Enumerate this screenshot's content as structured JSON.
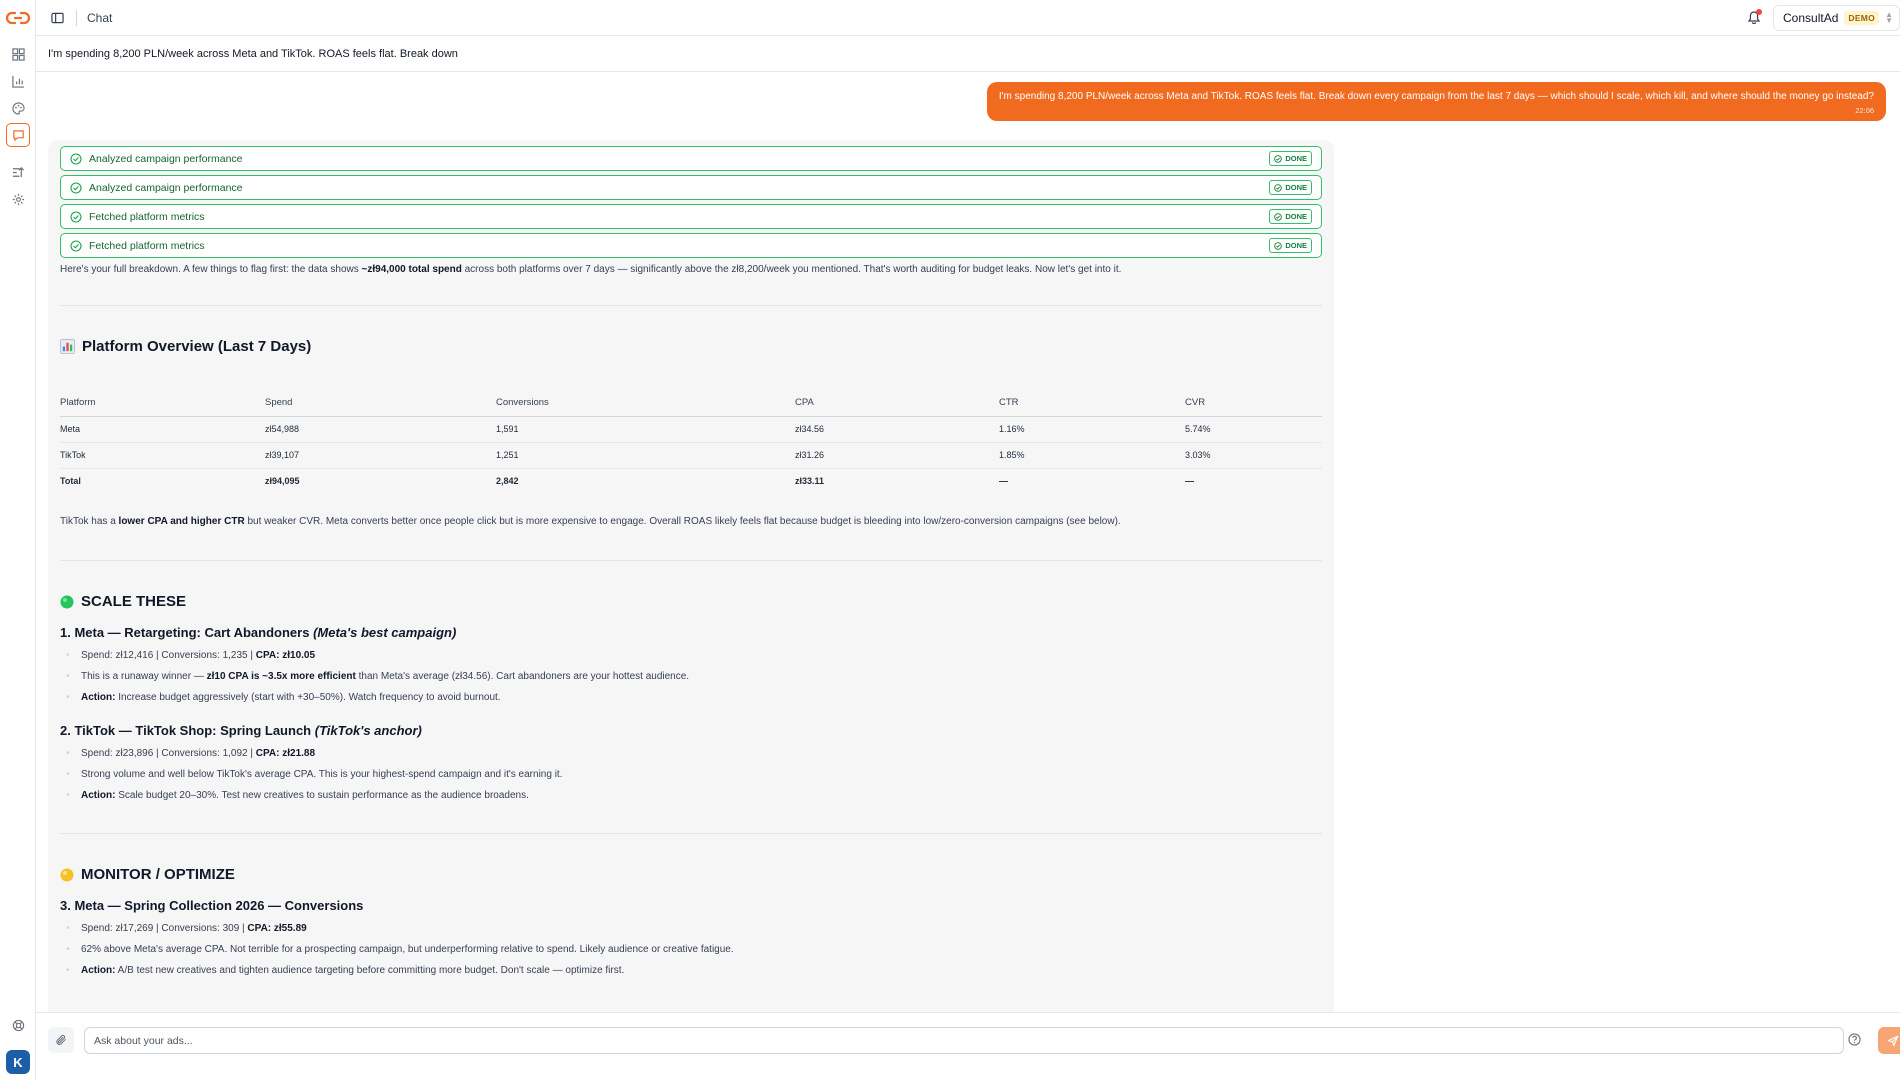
{
  "app": {
    "title": "Chat",
    "workspace": "ConsultAd",
    "workspace_badge": "DEMO",
    "avatar_initial": "K"
  },
  "conversation": {
    "title": "I'm spending 8,200 PLN/week across Meta and TikTok. ROAS feels flat. Break down"
  },
  "user_message": {
    "text": "I'm spending 8,200 PLN/week across Meta and TikTok. ROAS feels flat. Break down every campaign from the last 7 days — which should I scale, which kill, and where should the money go instead?",
    "time": "22:06"
  },
  "tool_calls": [
    {
      "label": "Analyzed campaign performance",
      "status": "DONE"
    },
    {
      "label": "Analyzed campaign performance",
      "status": "DONE"
    },
    {
      "label": "Fetched platform metrics",
      "status": "DONE"
    },
    {
      "label": "Fetched platform metrics",
      "status": "DONE"
    }
  ],
  "reply": {
    "intro_a": "Here's your full breakdown. A few things to flag first: the data shows ",
    "intro_b": "~zł94,000 total spend",
    "intro_c": " across both platforms over 7 days — significantly above the zł8,200/week you mentioned. That's worth auditing for budget leaks. Now let's get into it.",
    "overview_heading": "Platform Overview (Last 7 Days)",
    "table": {
      "headers": [
        "Platform",
        "Spend",
        "Conversions",
        "CPA",
        "CTR",
        "CVR"
      ],
      "rows": [
        [
          "Meta",
          "zł54,988",
          "1,591",
          "zł34.56",
          "1.16%",
          "5.74%"
        ],
        [
          "TikTok",
          "zł39,107",
          "1,251",
          "zł31.26",
          "1.85%",
          "3.03%"
        ]
      ],
      "total": [
        "Total",
        "zł94,095",
        "2,842",
        "zł33.11",
        "—",
        "—"
      ]
    },
    "summary_a": "TikTok has a ",
    "summary_b": "lower CPA and higher CTR",
    "summary_c": " but weaker CVR. Meta converts better once people click but is more expensive to engage. Overall ROAS likely feels flat because budget is bleeding into low/zero-conversion campaigns (see below).",
    "scale_heading": "SCALE THESE",
    "c1_title": "1. Meta — Retargeting: Cart Abandoners ",
    "c1_note": "(Meta's best campaign)",
    "c1_b1_a": "Spend: zł12,416 | Conversions: 1,235 | ",
    "c1_b1_b": "CPA: zł10.05",
    "c1_b2_a": "This is a runaway winner — ",
    "c1_b2_b": "zł10 CPA is ~3.5x more efficient",
    "c1_b2_c": " than Meta's average (zł34.56). Cart abandoners are your hottest audience.",
    "c1_b3_a": "Action:",
    "c1_b3_b": " Increase budget aggressively (start with +30–50%). Watch frequency to avoid burnout.",
    "c2_title": "2. TikTok — TikTok Shop: Spring Launch ",
    "c2_note": "(TikTok's anchor)",
    "c2_b1_a": "Spend: zł23,896 | Conversions: 1,092 | ",
    "c2_b1_b": "CPA: zł21.88",
    "c2_b2": "Strong volume and well below TikTok's average CPA. This is your highest-spend campaign and it's earning it.",
    "c2_b3_a": "Action:",
    "c2_b3_b": " Scale budget 20–30%. Test new creatives to sustain performance as the audience broadens.",
    "monitor_heading": "MONITOR / OPTIMIZE",
    "c3_title": "3. Meta — Spring Collection 2026 — Conversions",
    "c3_b1_a": "Spend: zł17,269 | Conversions: 309 | ",
    "c3_b1_b": "CPA: zł55.89",
    "c3_b2": "62% above Meta's average CPA. Not terrible for a prospecting campaign, but underperforming relative to spend. Likely audience or creative fatigue.",
    "c3_b3_a": "Action:",
    "c3_b3_b": " A/B test new creatives and tighten audience targeting before committing more budget. Don't scale — optimize first."
  },
  "composer": {
    "placeholder": "Ask about your ads..."
  },
  "colors": {
    "accent": "#f06a20",
    "success": "#34c06a",
    "scale": "#22c55e",
    "monitor": "#facc15"
  }
}
